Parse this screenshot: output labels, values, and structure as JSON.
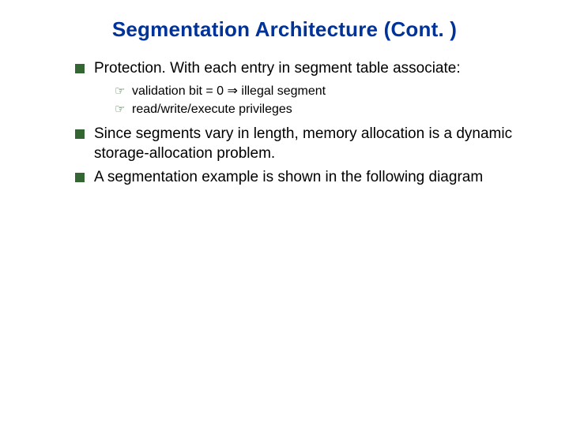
{
  "title": "Segmentation Architecture (Cont. )",
  "bullets": [
    {
      "text": "Protection.  With each entry in segment table associate:",
      "sub": [
        {
          "text_pre": "validation bit = 0 ",
          "arrow": "⇒",
          "text_post": " illegal segment"
        },
        {
          "text_pre": "read/write/execute privileges",
          "arrow": "",
          "text_post": ""
        }
      ]
    },
    {
      "text": "Since segments vary in length, memory allocation is a dynamic storage-allocation problem.",
      "sub": []
    },
    {
      "text": "A segmentation example is shown in the following diagram",
      "sub": []
    }
  ]
}
